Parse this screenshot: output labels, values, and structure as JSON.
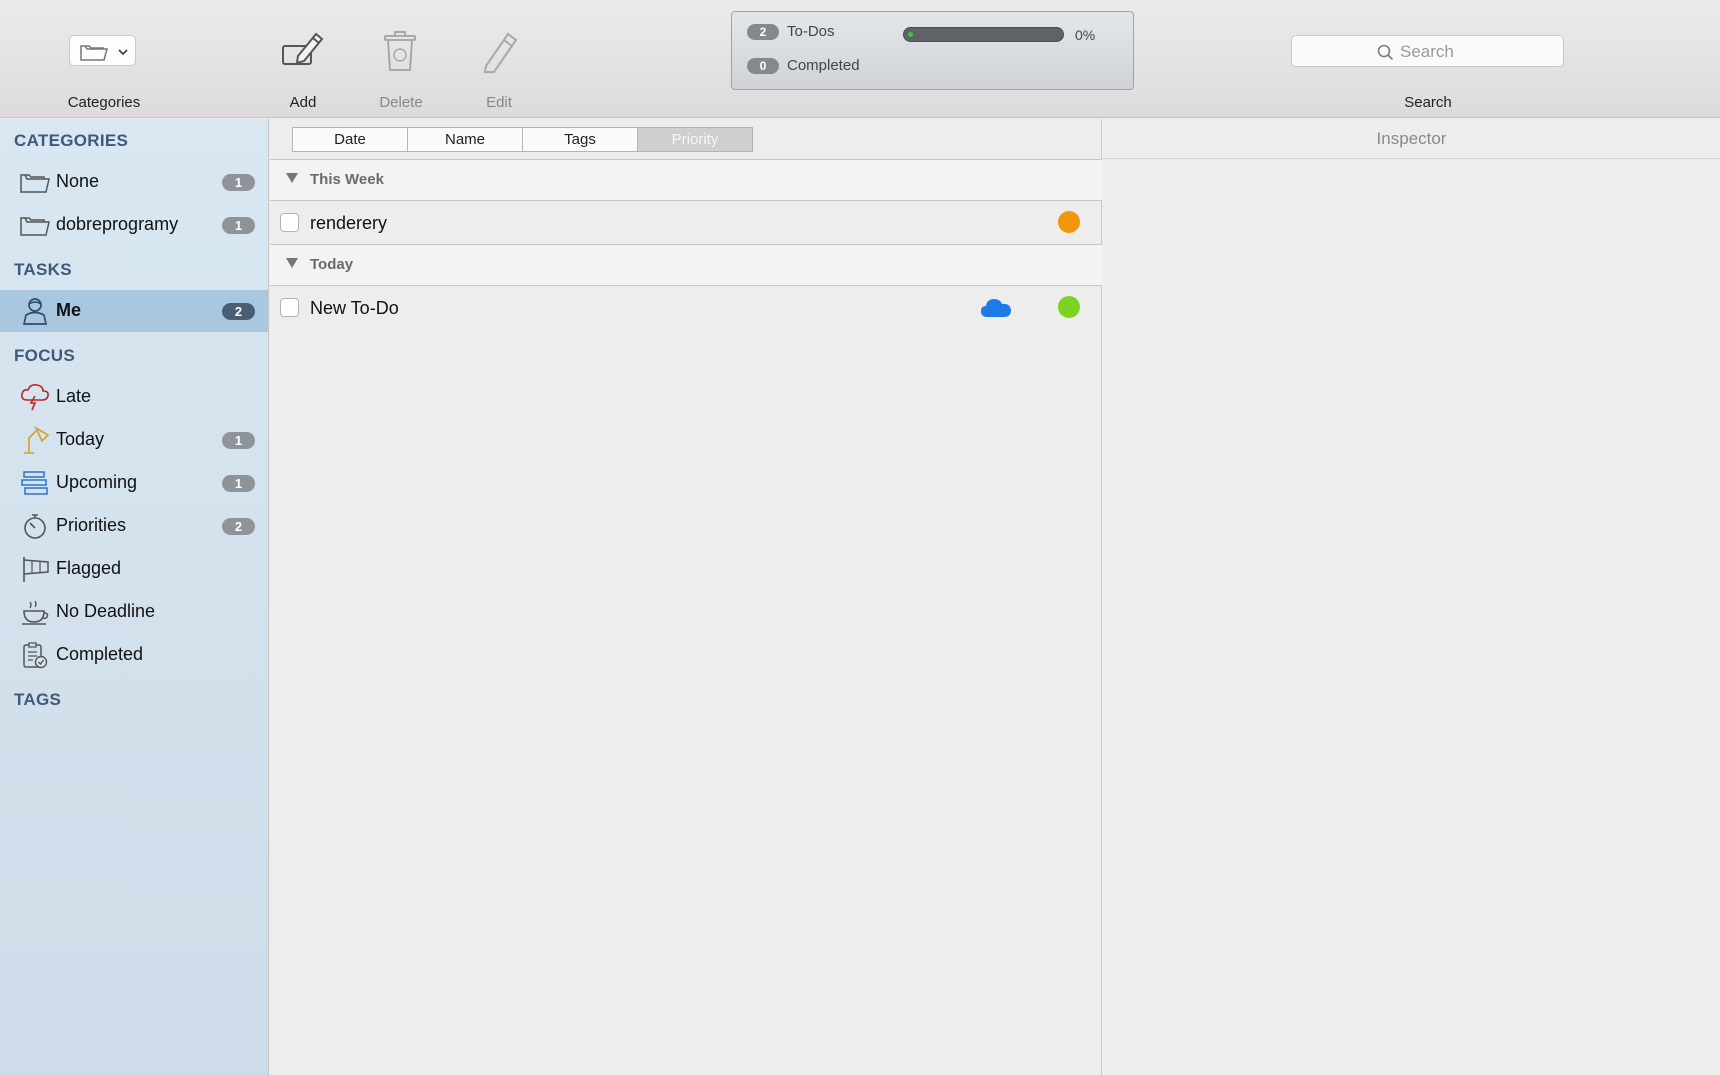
{
  "toolbar": {
    "categories_label": "Categories",
    "add_label": "Add",
    "delete_label": "Delete",
    "edit_label": "Edit",
    "search_label": "Search",
    "search_placeholder": "Search",
    "status": {
      "todos_count": "2",
      "todos_label": "To-Dos",
      "completed_count": "0",
      "completed_label": "Completed",
      "progress_percent_text": "0%",
      "progress_value": 0
    }
  },
  "sidebar": {
    "categories_header": "CATEGORIES",
    "categories": [
      {
        "label": "None",
        "count": "1",
        "icon": "folder-icon"
      },
      {
        "label": "dobreprogramy",
        "count": "1",
        "icon": "folder-icon"
      }
    ],
    "tasks_header": "TASKS",
    "tasks": [
      {
        "label": "Me",
        "count": "2",
        "icon": "person-icon",
        "selected": true
      }
    ],
    "focus_header": "FOCUS",
    "focus": [
      {
        "label": "Late",
        "count": "",
        "icon": "storm-cloud-icon"
      },
      {
        "label": "Today",
        "count": "1",
        "icon": "desk-lamp-icon"
      },
      {
        "label": "Upcoming",
        "count": "1",
        "icon": "stack-icon"
      },
      {
        "label": "Priorities",
        "count": "2",
        "icon": "stopwatch-icon"
      },
      {
        "label": "Flagged",
        "count": "",
        "icon": "windsock-flag-icon"
      },
      {
        "label": "No Deadline",
        "count": "",
        "icon": "coffee-cup-icon"
      },
      {
        "label": "Completed",
        "count": "",
        "icon": "clipboard-check-icon"
      }
    ],
    "tags_header": "TAGS"
  },
  "list": {
    "sort_buttons": [
      "Date",
      "Name",
      "Tags",
      "Priority"
    ],
    "active_sort": "Priority",
    "groups": [
      {
        "label": "This Week",
        "tasks": [
          {
            "title": "renderery",
            "priority_color": "#f0960f",
            "cloud": false
          }
        ]
      },
      {
        "label": "Today",
        "tasks": [
          {
            "title": "New To-Do",
            "priority_color": "#7ed321",
            "cloud": true
          }
        ]
      }
    ]
  },
  "inspector": {
    "title": "Inspector"
  },
  "colors": {
    "cloud": "#1e7ae6",
    "selected_row": "#a9c8df",
    "section_header": "#3e5a78"
  }
}
